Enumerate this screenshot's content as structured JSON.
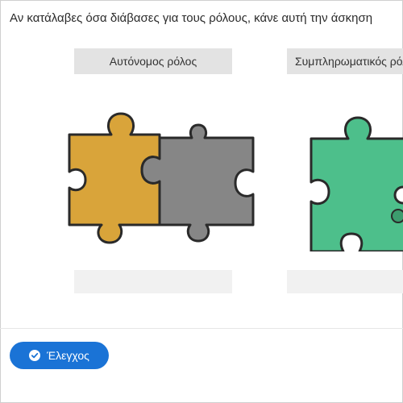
{
  "instruction": "Αν κατάλαβες όσα διάβασες για τους ρόλους, κάνε αυτή την άσκηση",
  "cards": [
    {
      "label": "Αυτόνομος ρόλος",
      "puzzle_colors": [
        "#d9a43a",
        "#868686"
      ],
      "icon": "puzzle-pieces-icon"
    },
    {
      "label": "Συμπληρωματικός ρόλος",
      "puzzle_colors": [
        "#4dbf8b"
      ],
      "icon": "puzzle-piece-icon"
    }
  ],
  "check_button": {
    "label": "Έλεγχος",
    "icon": "check-circle-icon",
    "color": "#1a73d6"
  }
}
